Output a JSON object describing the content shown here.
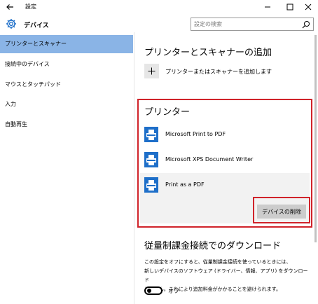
{
  "window": {
    "title": "設定"
  },
  "header": {
    "app_title": "デバイス",
    "search_placeholder": "設定の検索"
  },
  "sidebar": {
    "items": [
      {
        "label": "プリンターとスキャナー",
        "active": true
      },
      {
        "label": "接続中のデバイス",
        "active": false
      },
      {
        "label": "マウスとタッチパッド",
        "active": false
      },
      {
        "label": "入力",
        "active": false
      },
      {
        "label": "自動再生",
        "active": false
      }
    ]
  },
  "main": {
    "add_section": {
      "heading": "プリンターとスキャナーの追加",
      "add_label": "プリンターまたはスキャナーを追加します"
    },
    "printers_section": {
      "heading": "プリンター",
      "items": [
        {
          "name": "Microsoft Print to PDF"
        },
        {
          "name": "Microsoft XPS Document Writer"
        },
        {
          "name": "Print as a PDF"
        }
      ],
      "remove_button": "デバイスの削除"
    },
    "metered_section": {
      "heading": "従量制課金接続でのダウンロード",
      "description_lines": [
        "この設定をオフにすると、従量制課金接続を使っているときには、",
        "新しいデバイスのソフトウェア (ドライバー、情報、アプリ) をダウンロード",
        "しません。これにより追加料金がかかることを避けられます。"
      ],
      "toggle_state": "オフ"
    }
  },
  "colors": {
    "accent": "#8ab4e6",
    "highlight_outline": "#d0232a",
    "printer_icon": "#1e6fc9"
  }
}
